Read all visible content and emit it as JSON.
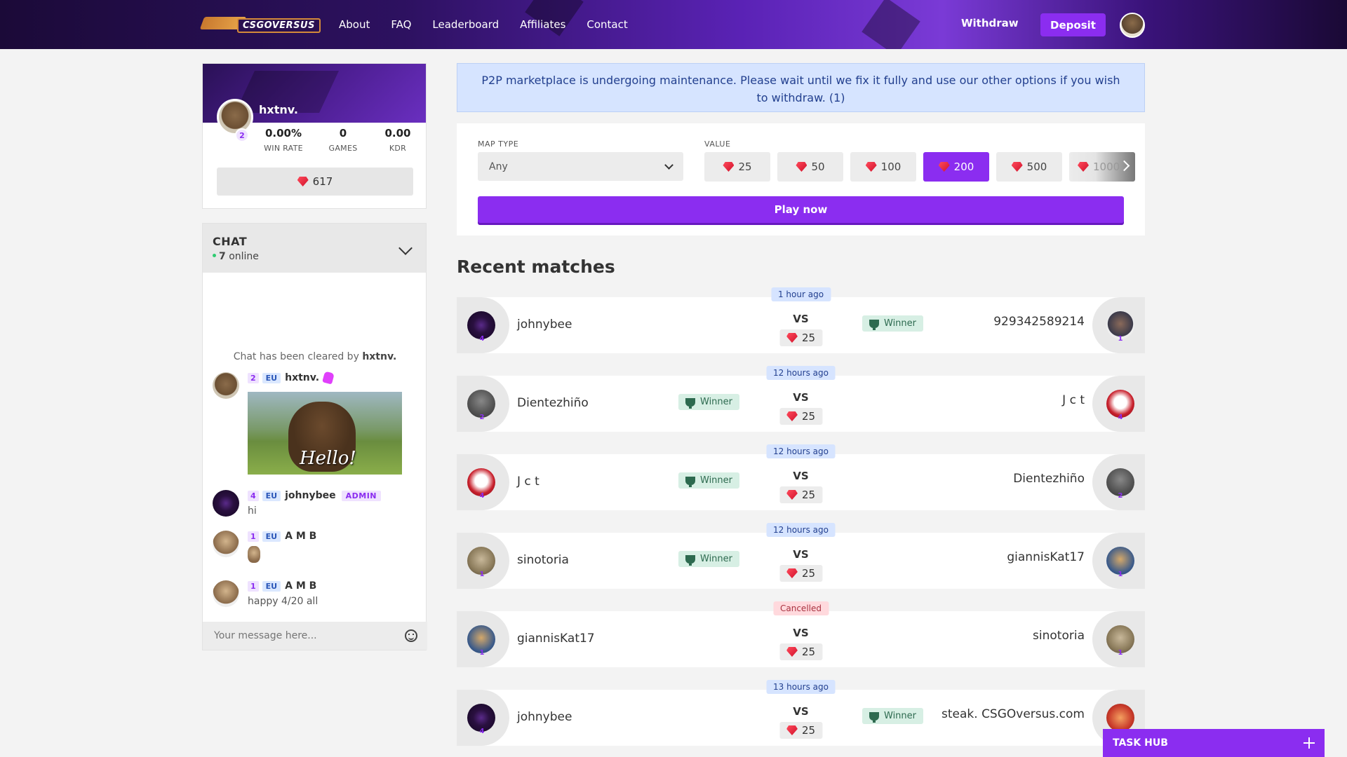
{
  "brand": {
    "logo_text": "CSGOVERSUS"
  },
  "nav": {
    "links": [
      "About",
      "FAQ",
      "Leaderboard",
      "Affiliates",
      "Contact"
    ],
    "withdraw": "Withdraw",
    "deposit": "Deposit"
  },
  "profile": {
    "name": "hxtnv.",
    "level": "2",
    "win_rate": "0.00%",
    "win_rate_label": "WIN RATE",
    "games": "0",
    "games_label": "GAMES",
    "kdr": "0.00",
    "kdr_label": "KDR",
    "balance": "617"
  },
  "chat": {
    "title": "CHAT",
    "online_count": "7",
    "online_label": "online",
    "cleared_prefix": "Chat has been cleared by",
    "cleared_by": "hxtnv.",
    "messages": [
      {
        "level": "2",
        "region": "EU",
        "name": "hxtnv.",
        "gif_caption": "Hello!"
      },
      {
        "level": "4",
        "region": "EU",
        "name": "johnybee",
        "role": "ADMIN",
        "text": "hi"
      },
      {
        "level": "1",
        "region": "EU",
        "name": "A M B"
      },
      {
        "level": "1",
        "region": "EU",
        "name": "A M B",
        "text": "happy 4/20 all"
      }
    ],
    "input_placeholder": "Your message here..."
  },
  "alert": {
    "text": "P2P marketplace is undergoing maintenance. Please wait until we fix it fully and use our other options if you wish to withdraw. (1)"
  },
  "game": {
    "map_type_label": "MAP TYPE",
    "map_type_value": "Any",
    "value_label": "VALUE",
    "values": [
      "25",
      "50",
      "100",
      "200",
      "500",
      "1000"
    ],
    "selected_value": "200",
    "play_label": "Play now"
  },
  "recent": {
    "title": "Recent matches",
    "vs_label": "VS",
    "winner_label": "Winner",
    "matches": [
      {
        "time": "1 hour ago",
        "left": "johnybee",
        "left_level": "4",
        "right": "929342589214",
        "right_level": "1",
        "stake": "25",
        "winner": "right"
      },
      {
        "time": "12 hours ago",
        "left": "Dientezhiño",
        "left_level": "2",
        "right": "J c t",
        "right_level": "4",
        "stake": "25",
        "winner": "left"
      },
      {
        "time": "12 hours ago",
        "left": "J c t",
        "left_level": "4",
        "right": "Dientezhiño",
        "right_level": "2",
        "stake": "25",
        "winner": "left"
      },
      {
        "time": "12 hours ago",
        "left": "sinotoria",
        "left_level": "1",
        "right": "giannisKat17",
        "right_level": "1",
        "stake": "25",
        "winner": "left"
      },
      {
        "time": "Cancelled",
        "left": "giannisKat17",
        "left_level": "1",
        "right": "sinotoria",
        "right_level": "1",
        "stake": "25",
        "winner": "none"
      },
      {
        "time": "13 hours ago",
        "left": "johnybee",
        "left_level": "4",
        "right": "steak. CSGOversus.com",
        "right_level": "",
        "stake": "25",
        "winner": "right"
      }
    ]
  },
  "task_hub": {
    "label": "TASK HUB"
  },
  "colors": {
    "accent": "#8b2df0",
    "alert_bg": "#d6e4ff",
    "winner_bg": "#d7efe4",
    "cancel_bg": "#ffd9dd"
  }
}
